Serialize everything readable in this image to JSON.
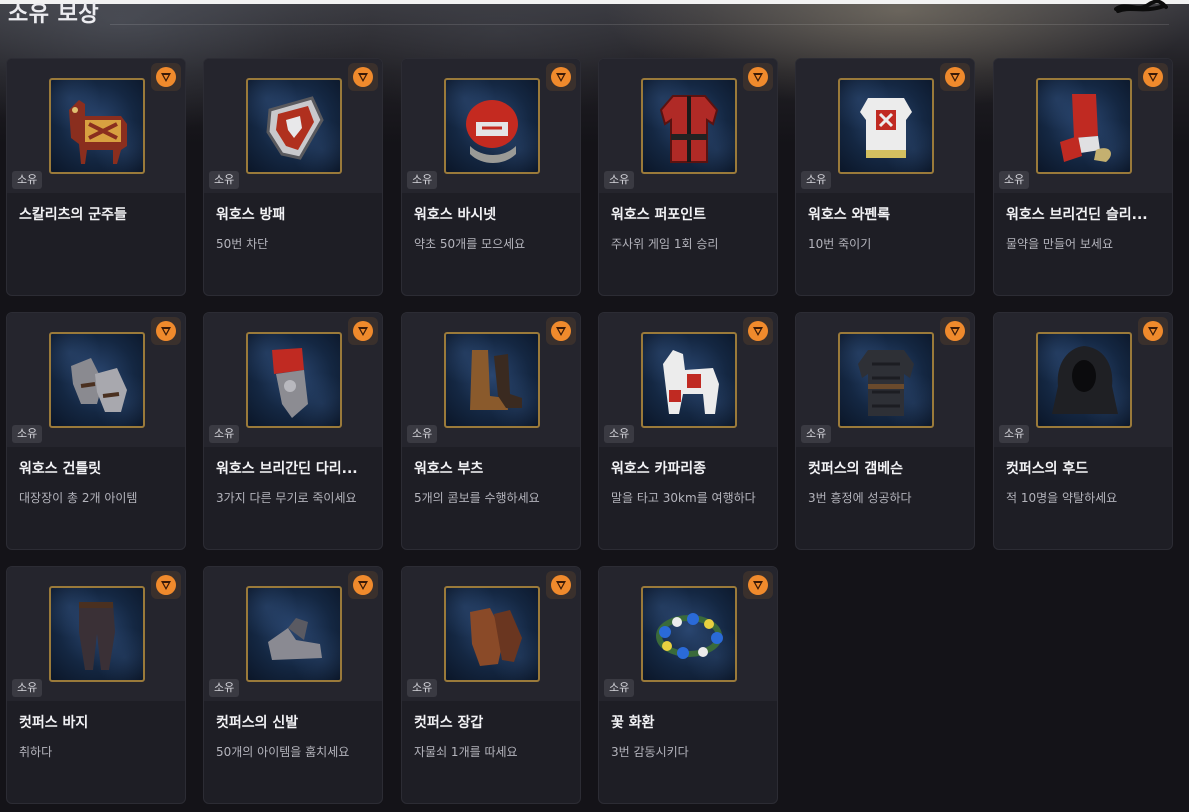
{
  "page": {
    "title": "소유 보상"
  },
  "colors": {
    "badge": "#f08a2c",
    "frame": "#9a7a3a",
    "card": "#1e1e25"
  },
  "rewards": [
    {
      "name": "스칼리츠의 군주들",
      "desc": "",
      "tag": "소유",
      "icon": "horse-barding-icon"
    },
    {
      "name": "워호스 방패",
      "desc": "50번 차단",
      "tag": "소유",
      "icon": "shield-icon"
    },
    {
      "name": "워호스 바시넷",
      "desc": "약초 50개를 모으세요",
      "tag": "소유",
      "icon": "helmet-icon"
    },
    {
      "name": "워호스 퍼포인트",
      "desc": "주사위 게임 1회 승리",
      "tag": "소유",
      "icon": "padded-jacket-icon"
    },
    {
      "name": "워호스 와펜록",
      "desc": "10번 죽이기",
      "tag": "소유",
      "icon": "tabard-icon"
    },
    {
      "name": "워호스 브리건딘 슬리...",
      "desc": "물약을 만들어 보세요",
      "tag": "소유",
      "icon": "sleeves-icon"
    },
    {
      "name": "워호스 건틀릿",
      "desc": "대장장이 총 2개 아이템",
      "tag": "소유",
      "icon": "gauntlets-icon"
    },
    {
      "name": "워호스 브리간딘 다리...",
      "desc": "3가지 다른 무기로 죽이세요",
      "tag": "소유",
      "icon": "leg-armor-icon"
    },
    {
      "name": "워호스 부츠",
      "desc": "5개의 콤보를 수행하세요",
      "tag": "소유",
      "icon": "boots-icon"
    },
    {
      "name": "워호스 카파리종",
      "desc": "말을 타고 30km를 여행하다",
      "tag": "소유",
      "icon": "caparison-icon"
    },
    {
      "name": "컷퍼스의 갬베슨",
      "desc": "3번 흥정에 성공하다",
      "tag": "소유",
      "icon": "gambeson-icon"
    },
    {
      "name": "컷퍼스의 후드",
      "desc": "적 10명을 약탈하세요",
      "tag": "소유",
      "icon": "hood-icon"
    },
    {
      "name": "컷퍼스 바지",
      "desc": "취하다",
      "tag": "소유",
      "icon": "trousers-icon"
    },
    {
      "name": "컷퍼스의 신발",
      "desc": "50개의 아이템을 훔치세요",
      "tag": "소유",
      "icon": "shoes-icon"
    },
    {
      "name": "컷퍼스 장갑",
      "desc": "자물쇠 1개를 따세요",
      "tag": "소유",
      "icon": "gloves-icon"
    },
    {
      "name": "꽃 화환",
      "desc": "3번 감동시키다",
      "tag": "소유",
      "icon": "flower-wreath-icon"
    }
  ]
}
